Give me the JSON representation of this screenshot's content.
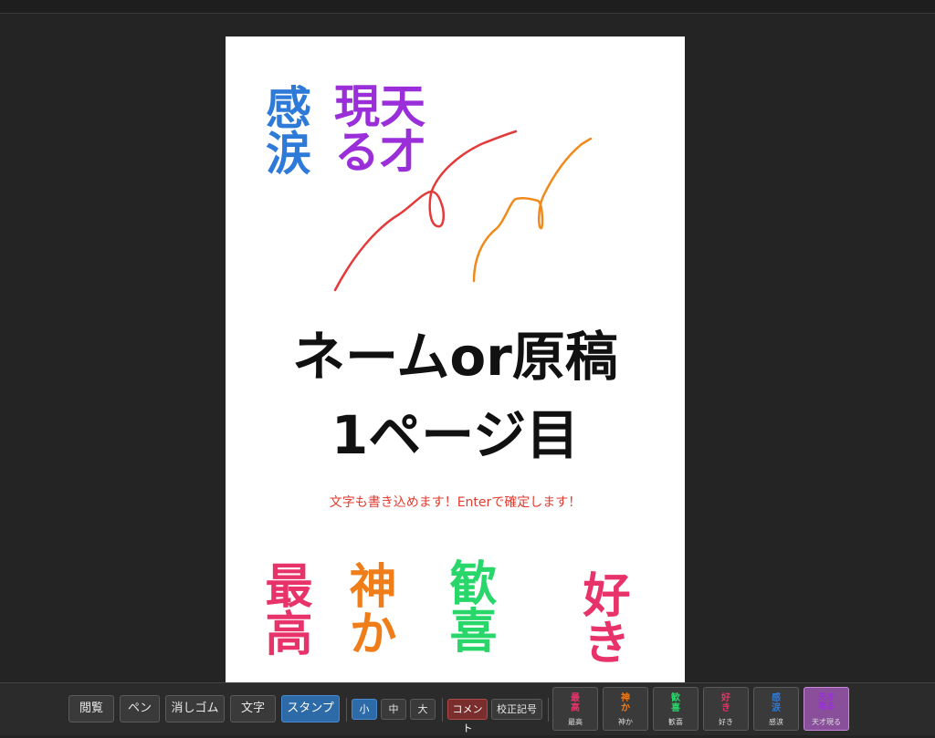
{
  "page": {
    "title_line1": "ネームor原稿",
    "title_line2": "1ページ目",
    "note": "文字も書き込めます！Enterで確定します！",
    "stamps": [
      {
        "text": "感涙",
        "color": "#2e7ad8"
      },
      {
        "text": "天才現る",
        "color": "#9a2ed8"
      },
      {
        "text": "最高",
        "color": "#e8326a"
      },
      {
        "text": "神か",
        "color": "#ef7d1a"
      },
      {
        "text": "歓喜",
        "color": "#28d66a"
      },
      {
        "text": "好き",
        "color": "#e8326a"
      }
    ],
    "stroke_colors": {
      "red": "#e33b3b",
      "orange": "#f08a1c"
    }
  },
  "toolbar": {
    "modes": {
      "view": "閲覧",
      "pen": "ペン",
      "eraser": "消しゴム",
      "text": "文字",
      "stamp": "スタンプ"
    },
    "active_mode": "スタンプ",
    "sizes": {
      "small": "小",
      "medium": "中",
      "large": "大"
    },
    "active_size": "小",
    "comment": "コメント",
    "proof_marks": "校正記号",
    "stamp_buttons": [
      {
        "glyph": "最高",
        "caption": "最高",
        "color": "#e8326a"
      },
      {
        "glyph": "神か",
        "caption": "神か",
        "color": "#ef7d1a"
      },
      {
        "glyph": "歓喜",
        "caption": "歓喜",
        "color": "#28d66a"
      },
      {
        "glyph": "好き",
        "caption": "好き",
        "color": "#e8326a"
      },
      {
        "glyph": "感涙",
        "caption": "感涙",
        "color": "#2e7ad8"
      },
      {
        "glyph": "天才現る",
        "caption": "天才現る",
        "color": "#9a2ed8"
      }
    ],
    "active_stamp": "天才現る"
  }
}
